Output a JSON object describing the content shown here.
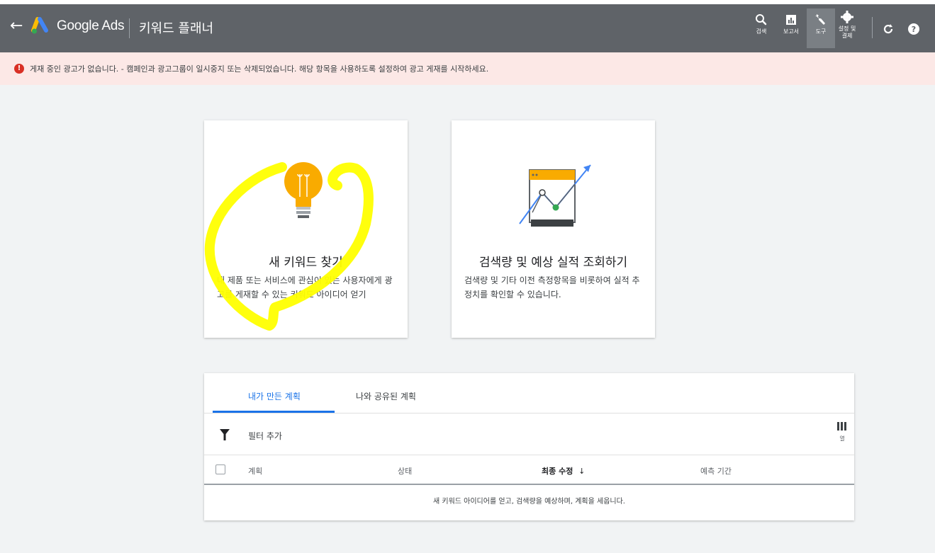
{
  "header": {
    "back_icon": "arrow-left-icon",
    "brand": "Google Ads",
    "page_title": "키워드 플래너",
    "tools": [
      {
        "label": "검색",
        "icon": "search-icon"
      },
      {
        "label": "보고서",
        "icon": "reports-icon"
      },
      {
        "label": "도구",
        "icon": "wrench-icon",
        "active": true
      },
      {
        "label": "설정 및 결제",
        "icon": "gear-icon"
      }
    ],
    "refresh_icon": "refresh-icon",
    "help_icon": "help-icon"
  },
  "alert": {
    "icon": "error-icon",
    "text": "게재 중인 광고가 없습니다. - 캠페인과 광고그룹이 일시중지 또는 삭제되었습니다. 해당 항목을 사용하도록 설정하여 광고 게재를 시작하세요."
  },
  "cards": [
    {
      "title": "새 키워드 찾기",
      "desc": "내 제품 또는 서비스에 관심이 있는 사용자에게 광고를 게재할 수 있는 키워드 아이디어 얻기",
      "icon": "lightbulb-icon"
    },
    {
      "title": "검색량 및 예상 실적 조회하기",
      "desc": "검색량 및 기타 이전 측정항목을 비롯하여 실적 추정치를 확인할 수 있습니다.",
      "icon": "trend-chart-icon"
    }
  ],
  "plans": {
    "tabs": [
      "내가 만든 계획",
      "나와 공유된 계획"
    ],
    "active_tab": 0,
    "filter_label": "필터 추가",
    "columns_label": "열",
    "columns": [
      "계획",
      "상태",
      "최종 수정",
      "예측 기간"
    ],
    "sort_indicator": "↓",
    "empty_text": "새 키워드 아이디어를 얻고, 검색량을 예상하며, 계획을 세웁니다."
  },
  "colors": {
    "header_bg": "#5f6368",
    "alert_bg": "#fce8e6",
    "accent": "#1a73e8",
    "highlight": "#ffff00"
  }
}
